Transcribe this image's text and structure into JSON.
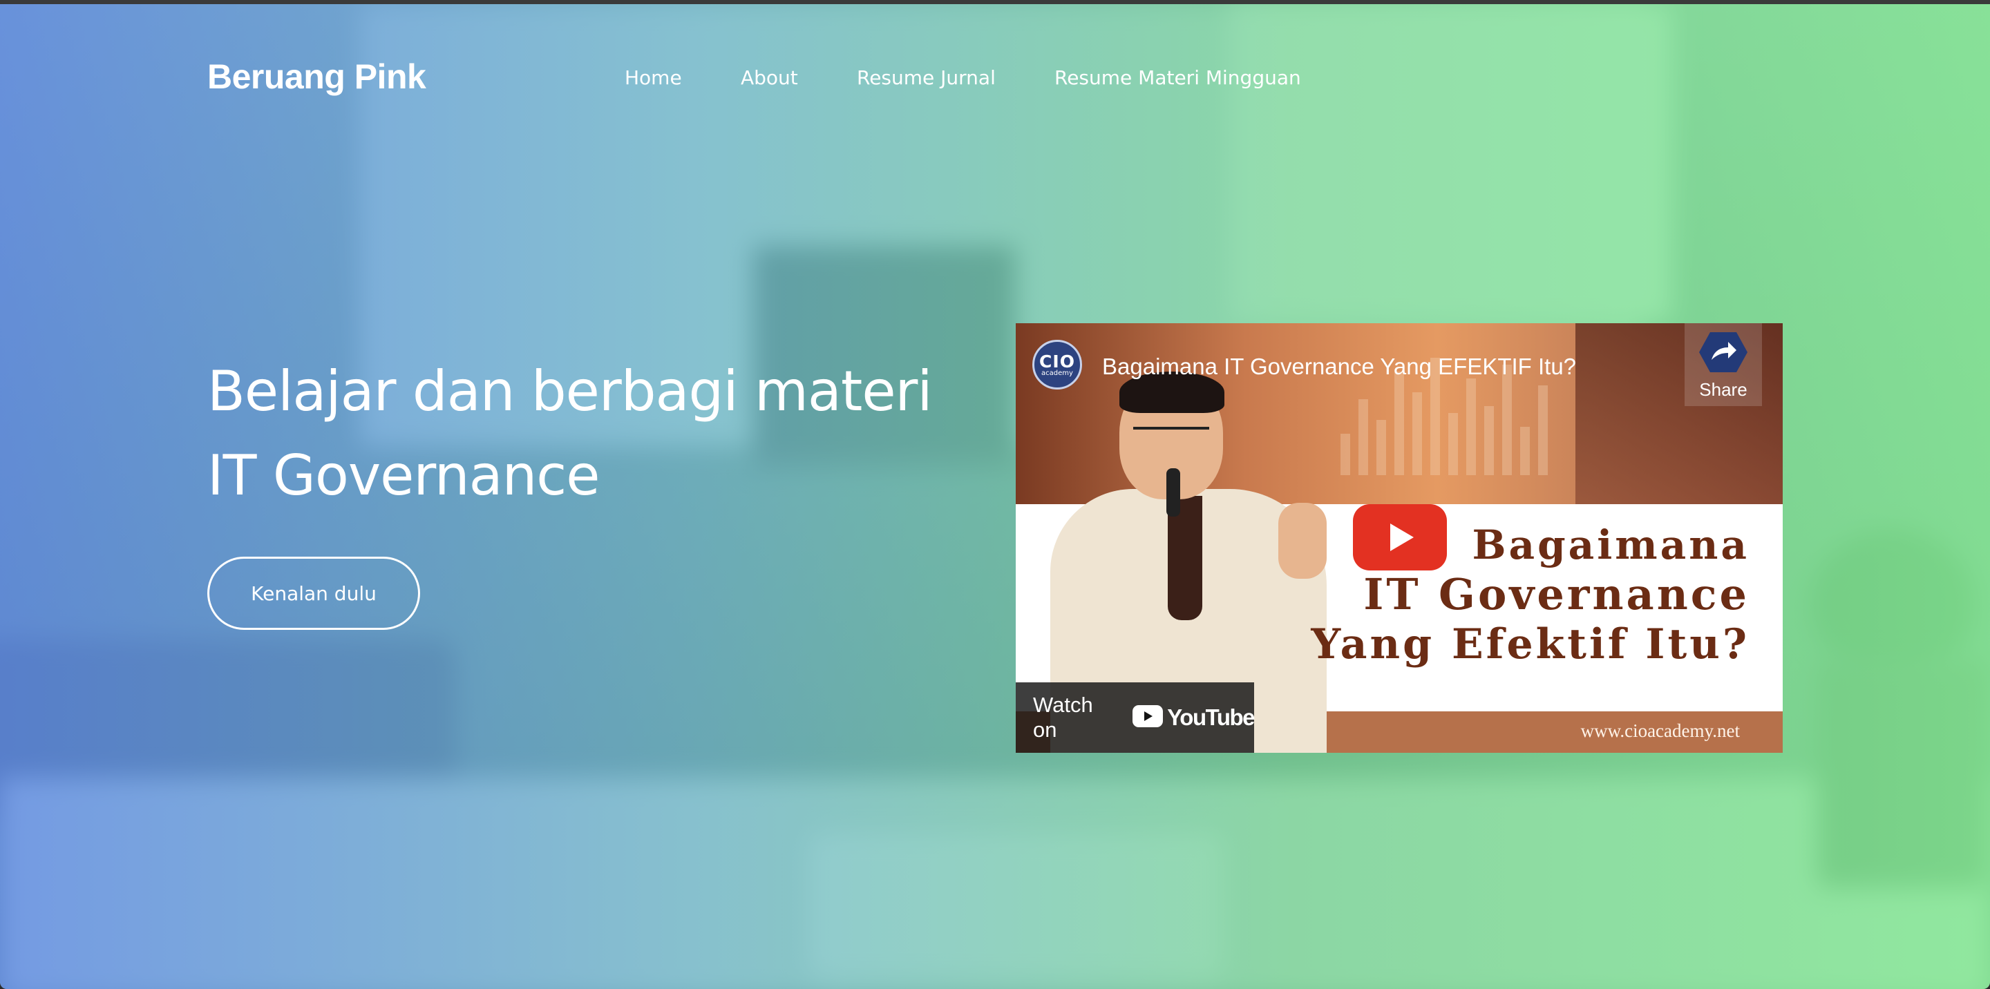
{
  "site": {
    "brand": "Beruang Pink",
    "nav": [
      {
        "label": "Home"
      },
      {
        "label": "About"
      },
      {
        "label": "Resume Jurnal"
      },
      {
        "label": "Resume Materi Mingguan"
      }
    ]
  },
  "hero": {
    "headline_line1": "Belajar dan berbagi materi",
    "headline_line2": "IT Governance",
    "cta_label": "Kenalan dulu"
  },
  "video": {
    "channel_logo_line1": "CIO",
    "channel_logo_line2": "academy",
    "title": "Bagaimana IT Governance Yang EFEKTIF Itu?",
    "share_label": "Share",
    "thumbnail_text_line1": "Bagaimana",
    "thumbnail_text_line2": "IT Governance",
    "thumbnail_text_line3": "Yang Efektif Itu?",
    "website": "www.cioacademy.net",
    "watch_on_label": "Watch on",
    "youtube_label": "YouTube"
  },
  "colors": {
    "gradient_left": "#5F8CE8",
    "gradient_right": "#87EB96",
    "youtube_red": "#E33122",
    "thumbnail_text": "#6B2C14"
  },
  "icons": {
    "play": "play-icon",
    "share": "share-arrow-icon",
    "youtube": "youtube-logo-icon"
  }
}
